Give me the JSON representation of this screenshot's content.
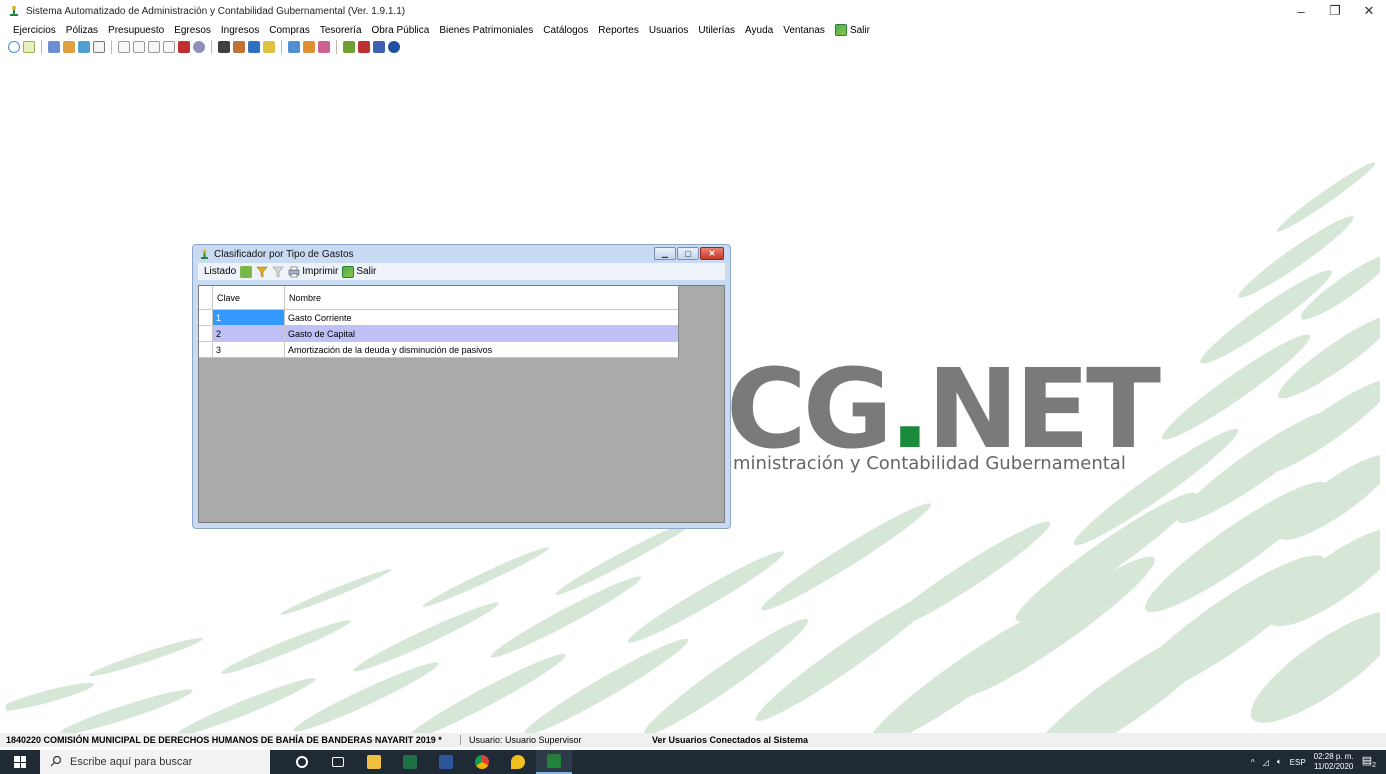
{
  "window": {
    "title": "Sistema Automatizado de Administración y Contabilidad Gubernamental  (Ver. 1.9.1.1)",
    "controls": [
      "–",
      "❐",
      "✕"
    ]
  },
  "menu": [
    "Ejercicios",
    "Pólizas",
    "Presupuesto",
    "Egresos",
    "Ingresos",
    "Compras",
    "Tesorería",
    "Obra Pública",
    "Bienes Patrimoniales",
    "Catálogos",
    "Reportes",
    "Usuarios",
    "Utilerías",
    "Ayuda",
    "Ventanas"
  ],
  "menu_exit": "Salir",
  "background": {
    "brand_main_prefix": "CG",
    "brand_dot": ".",
    "brand_main_suffix": "NET",
    "brand_sub": "ministración y Contabilidad Gubernamental"
  },
  "child_window": {
    "title": "Clasificador por Tipo de Gastos",
    "toolbar": {
      "listado": "Listado",
      "imprimir": "Imprimir",
      "salir": "Salir"
    },
    "grid": {
      "columns": [
        "Clave",
        "Nombre"
      ],
      "rows": [
        {
          "clave": "1",
          "nombre": "Gasto Corriente"
        },
        {
          "clave": "2",
          "nombre": "Gasto de Capital"
        },
        {
          "clave": "3",
          "nombre": "Amortización de la deuda y disminución de pasivos"
        }
      ]
    }
  },
  "statusbar": {
    "entity": "1840220 COMISIÓN MUNICIPAL DE DERECHOS HUMANOS DE BAHÍA DE BANDERAS NAYARIT  2019  *",
    "user": "Usuario: Usuario Supervisor",
    "connected": "Ver Usuarios Conectados al Sistema"
  },
  "taskbar": {
    "search_placeholder": "Escribe aquí para buscar",
    "language": "ESP",
    "time": "02:28 p. m.",
    "date": "11/02/2020",
    "notifications": "2"
  },
  "colors": {
    "accent_green": "#1b8a3a",
    "grid_selected": "#3399ff",
    "grid_alt_row": "#bfc0f5",
    "taskbar": "#1f2a35"
  }
}
